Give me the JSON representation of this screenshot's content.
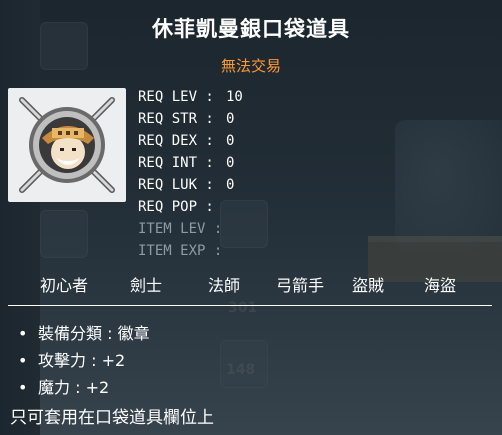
{
  "item": {
    "name": "休菲凱曼銀口袋道具",
    "trade_status": "無法交易",
    "icon": "pocket-item-portrait-icon"
  },
  "requirements": [
    {
      "label": "REQ LEV",
      "value": "10",
      "dim": false
    },
    {
      "label": "REQ STR",
      "value": "0",
      "dim": false
    },
    {
      "label": "REQ DEX",
      "value": "0",
      "dim": false
    },
    {
      "label": "REQ INT",
      "value": "0",
      "dim": false
    },
    {
      "label": "REQ LUK",
      "value": "0",
      "dim": false
    },
    {
      "label": "REQ POP",
      "value": "",
      "dim": false
    },
    {
      "label": "ITEM LEV",
      "value": "",
      "dim": true
    },
    {
      "label": "ITEM EXP",
      "value": "",
      "dim": true
    }
  ],
  "jobs": [
    "初心者",
    "劍士",
    "法師",
    "弓箭手",
    "盜賊",
    "海盜"
  ],
  "stats": [
    {
      "text": "裝備分類 : 徽章"
    },
    {
      "text": "攻擊力 : +2"
    },
    {
      "text": "魔力 : +2"
    }
  ],
  "description": "只可套用在口袋道具欄位上",
  "background": {
    "numbers": [
      "301",
      "148"
    ]
  },
  "colors": {
    "title": "#ffffff",
    "trade_status": "#ff9a33",
    "dim_text": "#8e9aa4"
  }
}
